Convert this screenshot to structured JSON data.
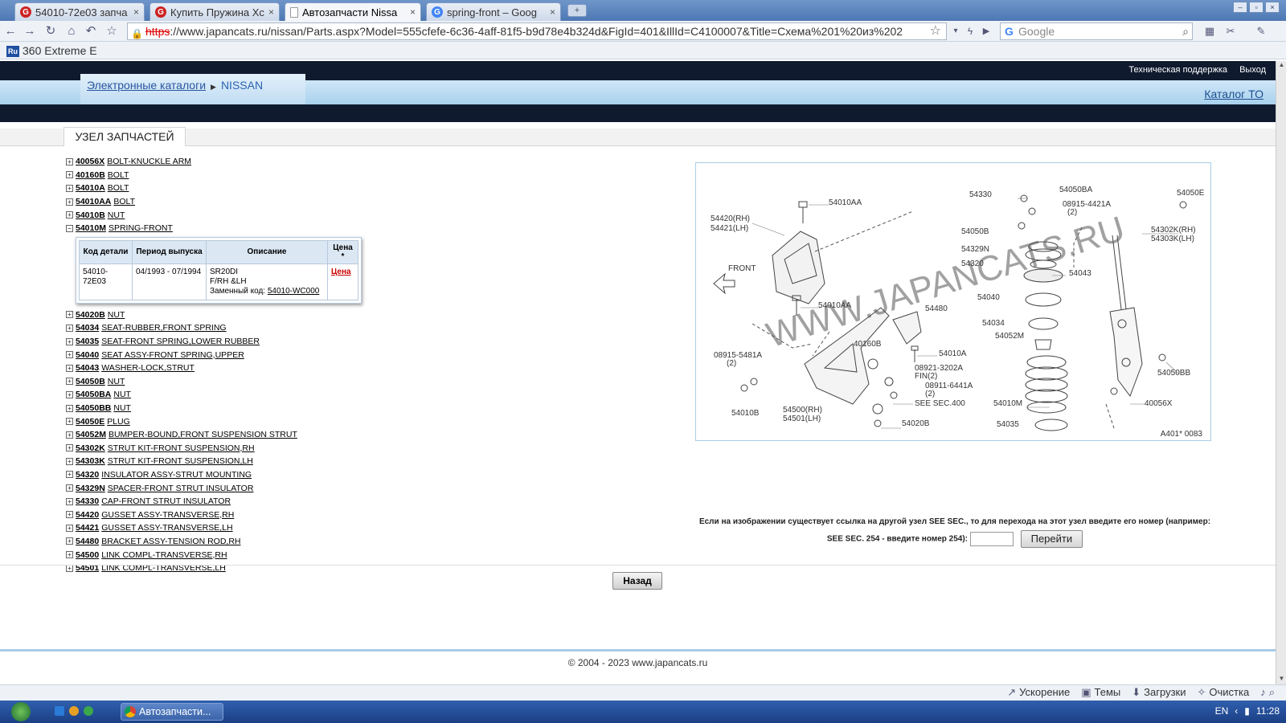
{
  "browser": {
    "tabs": [
      {
        "title": "54010-72e03 запча",
        "icon_color": "#cc2222"
      },
      {
        "title": "Купить Пружина Хс",
        "icon_color": "#cc2222"
      },
      {
        "title": "Автозапчасти Nissa",
        "icon_color": "#ffffff"
      },
      {
        "title": "spring-front – Goog",
        "icon_color": "#4285f4"
      }
    ],
    "url_https": "https",
    "url_rest": "://www.japancats.ru/nissan/Parts.aspx?Model=555cfefe-6c36-4aff-81f5-b9d78e4b324d&FigId=401&IllId=C4100007&Title=Схема%201%20из%202",
    "search_placeholder": "Google",
    "bookmark": "360 Extreme E"
  },
  "site": {
    "top_links": [
      "Техническая поддержка",
      "Выход"
    ],
    "breadcrumb": {
      "link": "Электронные каталоги",
      "current": "NISSAN"
    },
    "catalog_to": "Каталог ТО",
    "section_title": "УЗЕЛ ЗАПЧАСТЕЙ"
  },
  "parts": [
    {
      "code": "40056X",
      "name": "BOLT-KNUCKLE ARM",
      "expanded": false
    },
    {
      "code": "40160B",
      "name": "BOLT",
      "expanded": false
    },
    {
      "code": "54010A",
      "name": "BOLT",
      "expanded": false
    },
    {
      "code": "54010AA",
      "name": "BOLT",
      "expanded": false
    },
    {
      "code": "54010B",
      "name": "NUT",
      "expanded": false
    },
    {
      "code": "54010M",
      "name": "SPRING-FRONT",
      "expanded": true
    },
    {
      "code": "54020B",
      "name": "NUT",
      "expanded": false
    },
    {
      "code": "54034",
      "name": "SEAT-RUBBER,FRONT SPRING",
      "expanded": false
    },
    {
      "code": "54035",
      "name": "SEAT-FRONT SPRING,LOWER RUBBER",
      "expanded": false
    },
    {
      "code": "54040",
      "name": "SEAT ASSY-FRONT SPRING,UPPER",
      "expanded": false
    },
    {
      "code": "54043",
      "name": "WASHER-LOCK,STRUT",
      "expanded": false
    },
    {
      "code": "54050B",
      "name": "NUT",
      "expanded": false
    },
    {
      "code": "54050BA",
      "name": "NUT",
      "expanded": false
    },
    {
      "code": "54050BB",
      "name": "NUT",
      "expanded": false
    },
    {
      "code": "54050E",
      "name": "PLUG",
      "expanded": false
    },
    {
      "code": "54052M",
      "name": "BUMPER-BOUND,FRONT SUSPENSION STRUT",
      "expanded": false
    },
    {
      "code": "54302K",
      "name": "STRUT KIT-FRONT SUSPENSION,RH",
      "expanded": false
    },
    {
      "code": "54303K",
      "name": "STRUT KIT-FRONT SUSPENSION,LH",
      "expanded": false
    },
    {
      "code": "54320",
      "name": "INSULATOR ASSY-STRUT MOUNTING",
      "expanded": false
    },
    {
      "code": "54329N",
      "name": "SPACER-FRONT STRUT INSULATOR",
      "expanded": false
    },
    {
      "code": "54330",
      "name": "CAP-FRONT STRUT INSULATOR",
      "expanded": false
    },
    {
      "code": "54420",
      "name": "GUSSET ASSY-TRANSVERSE,RH",
      "expanded": false
    },
    {
      "code": "54421",
      "name": "GUSSET ASSY-TRANSVERSE,LH",
      "expanded": false
    },
    {
      "code": "54480",
      "name": "BRACKET ASSY-TENSION ROD,RH",
      "expanded": false
    },
    {
      "code": "54500",
      "name": "LINK COMPL-TRANSVERSE,RH",
      "expanded": false
    },
    {
      "code": "54501",
      "name": "LINK COMPL-TRANSVERSE,LH",
      "expanded": false
    }
  ],
  "detail": {
    "headers": [
      "Код детали",
      "Период выпуска",
      "Описание",
      "Цена *"
    ],
    "part_code": "54010-72E03",
    "period": "04/1993 - 07/1994",
    "desc_line1": "SR20DI",
    "desc_line2": "F/RH &LH",
    "replacement_label": "Заменный код:",
    "replacement_code": "54010-WC000",
    "price_label": "Цена"
  },
  "diagram": {
    "watermark": "WWW.JAPANCATS.RU",
    "ref": "A401* 0083",
    "labels": [
      "54010AA",
      "54420(RH)",
      "54421(LH)",
      "FRONT",
      "54010AA",
      "08915-5481A",
      "(2)",
      "54010B",
      "40160B",
      "54500(RH)",
      "54501(LH)",
      "54020B",
      "SEE SEC.400",
      "08921-3202A",
      "FIN(2)",
      "08911-6441A",
      "(2)",
      "54480",
      "54010A",
      "54330",
      "54050BA",
      "08915-4421A",
      "(2)",
      "54050B",
      "54329N",
      "54320",
      "54043",
      "54040",
      "54034",
      "54052M",
      "54010M",
      "54035",
      "54050E",
      "54302K(RH)",
      "54303K(LH)",
      "54050BB",
      "40056X"
    ]
  },
  "jump": {
    "text_line1": "Если на изображении существует ссылка на другой узел SEE SEC., то для перехода на этот узел введите его номер (например:",
    "text_line2": "SEE SEC. 254 - введите номер 254):",
    "button": "Перейти"
  },
  "back_button": "Назад",
  "copyright": "© 2004 - 2023 www.japancats.ru",
  "statusbar": [
    "Ускорение",
    "Темы",
    "Загрузки",
    "Очистка"
  ],
  "taskbar": {
    "item": "Автозапчасти...",
    "lang": "EN",
    "clock": "11:28"
  }
}
